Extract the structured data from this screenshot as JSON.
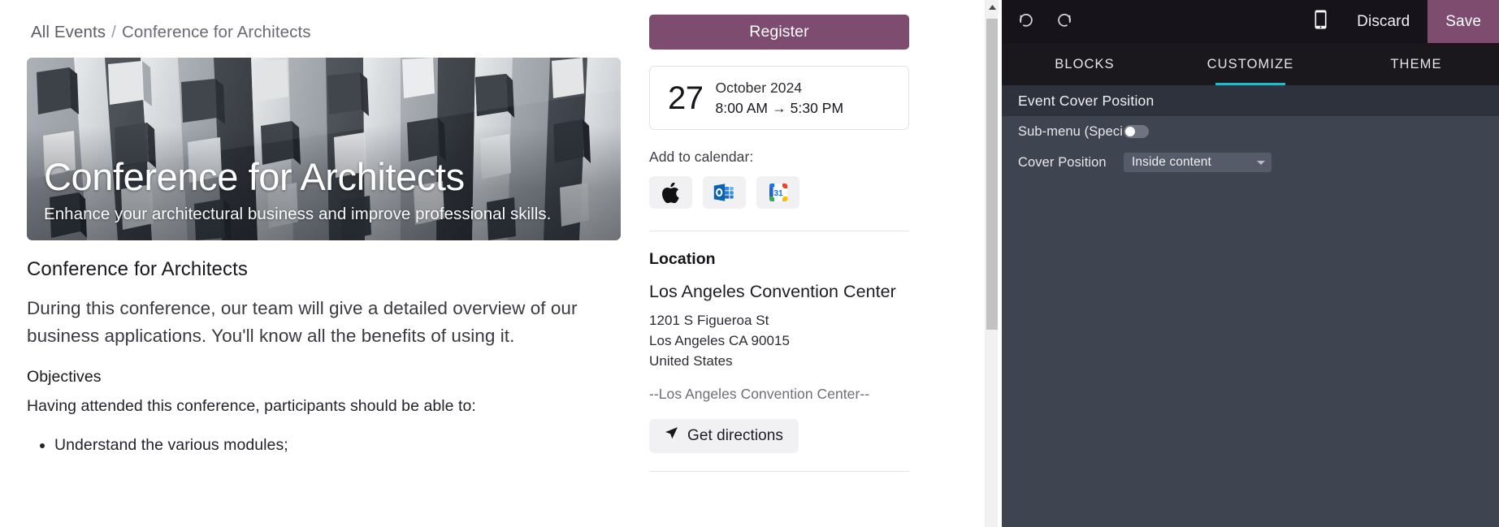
{
  "breadcrumb": {
    "root": "All Events",
    "separator": "/",
    "current": "Conference for Architects"
  },
  "hero": {
    "title": "Conference for Architects",
    "subtitle": "Enhance your architectural business and improve professional skills.",
    "image_alt": "architectural-facade-photo"
  },
  "article": {
    "heading": "Conference for Architects",
    "lead": "During this conference, our team will give a detailed overview of our business applications. You'll know all the benefits of using it.",
    "objectives_heading": "Objectives",
    "objectives_intro": "Having attended this conference, participants should be able to:",
    "objectives": [
      "Understand the various modules;"
    ]
  },
  "rail": {
    "register_label": "Register",
    "date": {
      "day": "27",
      "month_year": "October 2024",
      "start_time": "8:00 AM",
      "arrow": "→",
      "end_time": "5:30 PM"
    },
    "add_to_calendar_label": "Add to calendar:",
    "calendar_buttons": [
      {
        "name": "apple-calendar-icon",
        "title": "Apple"
      },
      {
        "name": "outlook-calendar-icon",
        "title": "Outlook"
      },
      {
        "name": "google-calendar-icon",
        "title": "Google Calendar",
        "day": "31"
      }
    ],
    "location": {
      "title": "Location",
      "venue": "Los Angeles Convention Center",
      "street": "1201 S Figueroa St",
      "city_state_zip": "Los Angeles CA 90015",
      "country": "United States",
      "note": "--Los Angeles Convention Center--",
      "directions_label": "Get directions"
    }
  },
  "editor": {
    "toolbar": {
      "undo_icon": "undo-icon",
      "redo_icon": "redo-icon",
      "mobile_icon": "mobile-preview-icon",
      "discard_label": "Discard",
      "save_label": "Save"
    },
    "tabs": [
      {
        "label": "BLOCKS",
        "active": false
      },
      {
        "label": "CUSTOMIZE",
        "active": true
      },
      {
        "label": "THEME",
        "active": false
      }
    ],
    "section_title": "Event Cover Position",
    "options": [
      {
        "label": "Sub-menu (Speci...",
        "type": "toggle",
        "value": false
      },
      {
        "label": "Cover Position",
        "type": "select",
        "value": "Inside content"
      }
    ]
  },
  "colors": {
    "accent_purple": "#7d4c6e",
    "tab_active_underline": "#2fb5c4",
    "editor_bg": "#3f4451",
    "editor_toolbar_bg": "#16131a",
    "editor_tabs_bg": "#1a171d",
    "editor_section_head_bg": "#2d323d"
  }
}
